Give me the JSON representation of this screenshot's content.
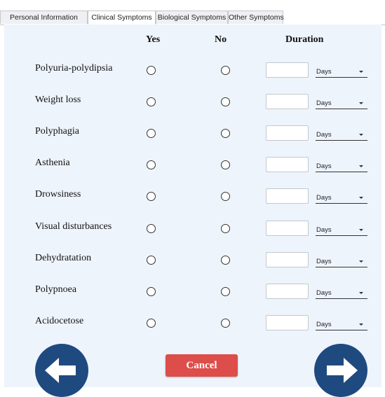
{
  "tabs": [
    {
      "label": "Personal Information",
      "active": false
    },
    {
      "label": "Clinical Symptoms",
      "active": true
    },
    {
      "label": "Biological Symptoms",
      "active": false
    },
    {
      "label": "Other Symptoms",
      "active": false
    }
  ],
  "columns": {
    "yes": "Yes",
    "no": "No",
    "duration": "Duration"
  },
  "symptoms": [
    {
      "label": "Polyuria-polydipsia",
      "unit": "Days"
    },
    {
      "label": "Weight loss",
      "unit": "Days"
    },
    {
      "label": "Polyphagia",
      "unit": "Days"
    },
    {
      "label": "Asthenia",
      "unit": "Days"
    },
    {
      "label": "Drowsiness",
      "unit": "Days"
    },
    {
      "label": "Visual disturbances",
      "unit": "Days"
    },
    {
      "label": "Dehydratation",
      "unit": "Days"
    },
    {
      "label": "Polypnoea",
      "unit": "Days"
    },
    {
      "label": "Acidocetose",
      "unit": "Days"
    }
  ],
  "buttons": {
    "back": {
      "icon": "arrow-left-icon"
    },
    "cancel": {
      "label": "Cancel",
      "color": "#dd4d4a"
    },
    "next": {
      "icon": "arrow-right-icon"
    }
  },
  "colors": {
    "panel_bg": "#eef4fc",
    "nav_button": "#1f4a80"
  }
}
